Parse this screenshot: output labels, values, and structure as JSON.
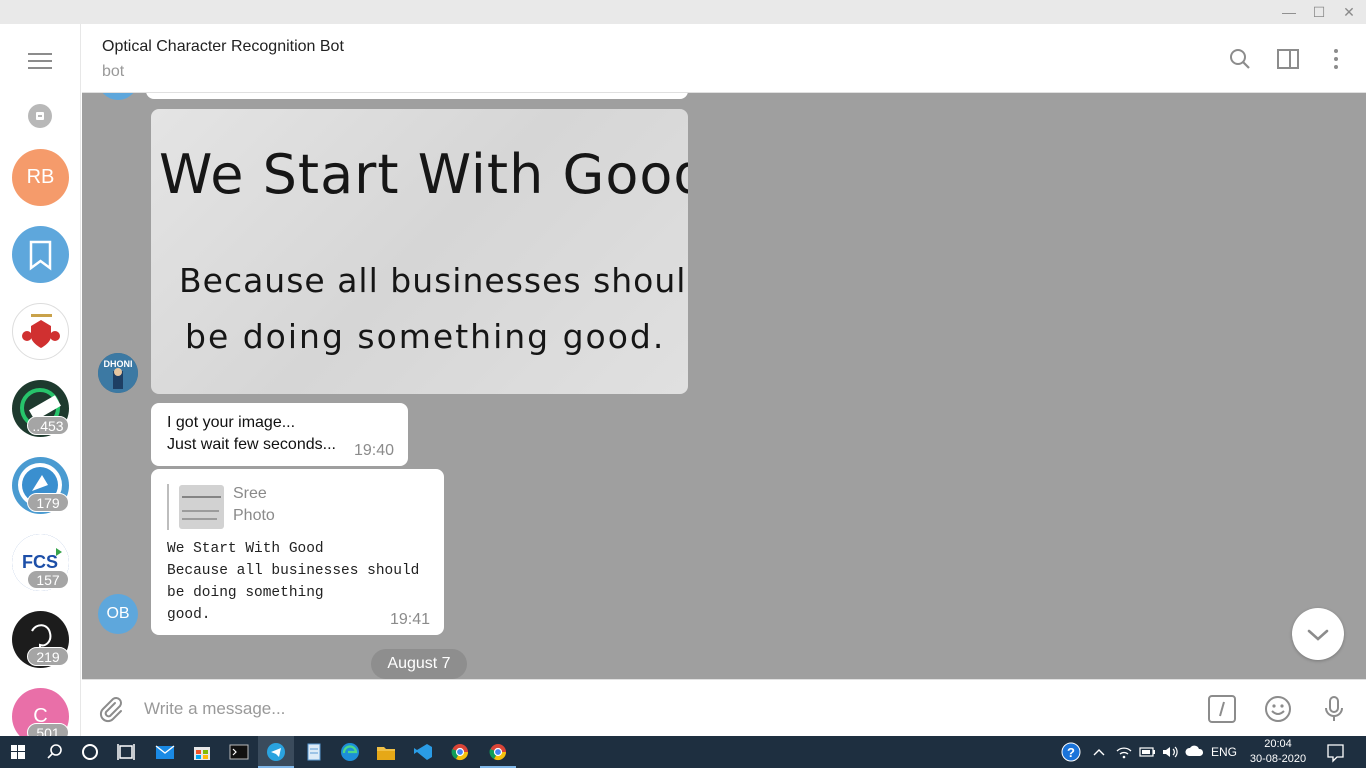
{
  "window": {
    "minimize_icon": "—",
    "maximize_icon": "☐",
    "close_icon": "✕"
  },
  "sidebar": {
    "menu_icon": "hamburger-icon",
    "archive_icon": "archive-icon",
    "chats": [
      {
        "initials": "RB",
        "color": "#f59b6b",
        "badge": ""
      },
      {
        "initials": "",
        "color": "#5ea7dc",
        "badge": ""
      },
      {
        "initials": "",
        "color": "#ffffff",
        "badge": ""
      },
      {
        "initials": "",
        "color": "#1e3a2e",
        "badge": "..453"
      },
      {
        "initials": "",
        "color": "#4a9bd1",
        "badge": "179"
      },
      {
        "initials": "",
        "color": "#2456a6",
        "badge": "157"
      },
      {
        "initials": "",
        "color": "#1c1c1c",
        "badge": "219"
      },
      {
        "initials": "C",
        "color": "#e96fa8",
        "badge": "501"
      }
    ]
  },
  "header": {
    "title": "Optical Character Recognition Bot",
    "subtitle": "bot"
  },
  "messages": {
    "photo_line1": "We Start With Good",
    "photo_line2": "Because all businesses should",
    "photo_line3": "be doing something good.",
    "msg1_line1": "I got your image...",
    "msg1_line2": "Just wait few seconds...",
    "msg1_time": "19:40",
    "reply_name": "Sree",
    "reply_type": "Photo",
    "ocr_text": "We Start With Good\nBecause all businesses should\nbe doing something\ngood.",
    "msg2_time": "19:41",
    "bot_avatar": "OB",
    "date_separator": "August 7"
  },
  "composer": {
    "placeholder": "Write a message..."
  },
  "taskbar": {
    "language": "ENG",
    "time": "20:04",
    "date": "30-08-2020"
  },
  "colors": {
    "chat_bg": "#9f9f9f",
    "accent": "#5ea7dc",
    "taskbar": "#1e2f40"
  }
}
